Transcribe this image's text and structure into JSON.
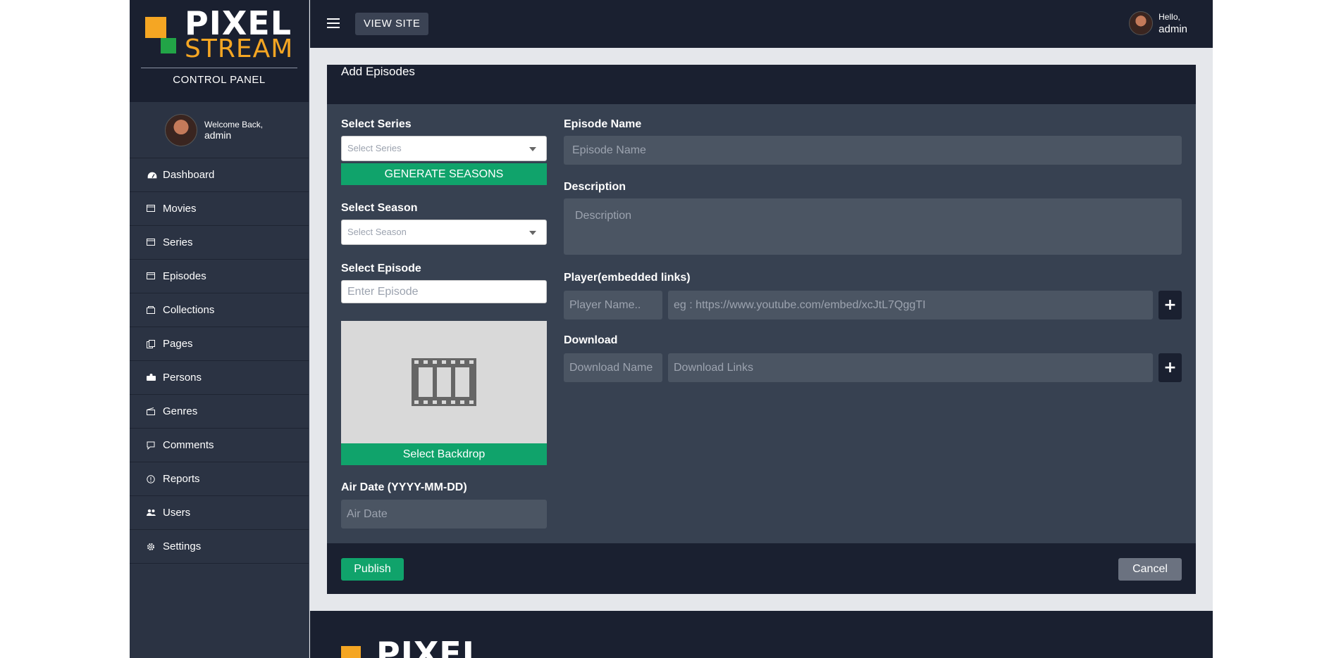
{
  "sidebar": {
    "brand": {
      "line1": "PIXEL",
      "line2": "STREAM",
      "subtitle": "CONTROL PANEL"
    },
    "user": {
      "greeting": "Welcome Back,",
      "name": "admin"
    },
    "items": [
      {
        "label": "Dashboard",
        "icon": "gauge-icon"
      },
      {
        "label": "Movies",
        "icon": "film-icon"
      },
      {
        "label": "Series",
        "icon": "film-icon"
      },
      {
        "label": "Episodes",
        "icon": "film-icon"
      },
      {
        "label": "Collections",
        "icon": "folder-icon"
      },
      {
        "label": "Pages",
        "icon": "pages-icon"
      },
      {
        "label": "Persons",
        "icon": "people-icon"
      },
      {
        "label": "Genres",
        "icon": "clapper-icon"
      },
      {
        "label": "Comments",
        "icon": "comment-icon"
      },
      {
        "label": "Reports",
        "icon": "alert-icon"
      },
      {
        "label": "Users",
        "icon": "users-icon"
      },
      {
        "label": "Settings",
        "icon": "gear-icon"
      }
    ]
  },
  "topbar": {
    "view_site": "VIEW SITE",
    "hello": "Hello,",
    "name": "admin"
  },
  "form": {
    "title": "Add Episodes",
    "select_series_label": "Select Series",
    "select_series_placeholder": "Select Series",
    "generate_seasons": "GENERATE SEASONS",
    "select_season_label": "Select Season",
    "select_season_placeholder": "Select Season",
    "select_episode_label": "Select Episode",
    "episode_placeholder": "Enter Episode",
    "select_backdrop": "Select Backdrop",
    "air_date_label": "Air Date (YYYY-MM-DD)",
    "air_date_placeholder": "Air Date",
    "episode_name_label": "Episode Name",
    "episode_name_placeholder": "Episode Name",
    "description_label": "Description",
    "description_placeholder": "Description",
    "player_label": "Player(embedded links)",
    "player_name_placeholder": "Player Name..",
    "player_link_placeholder": "eg : https://www.youtube.com/embed/xcJtL7QggTI",
    "download_label": "Download",
    "download_name_placeholder": "Download Name",
    "download_links_placeholder": "Download Links",
    "plus": "+",
    "publish": "Publish",
    "cancel": "Cancel"
  },
  "footer": {
    "brand": "PIXEL"
  }
}
